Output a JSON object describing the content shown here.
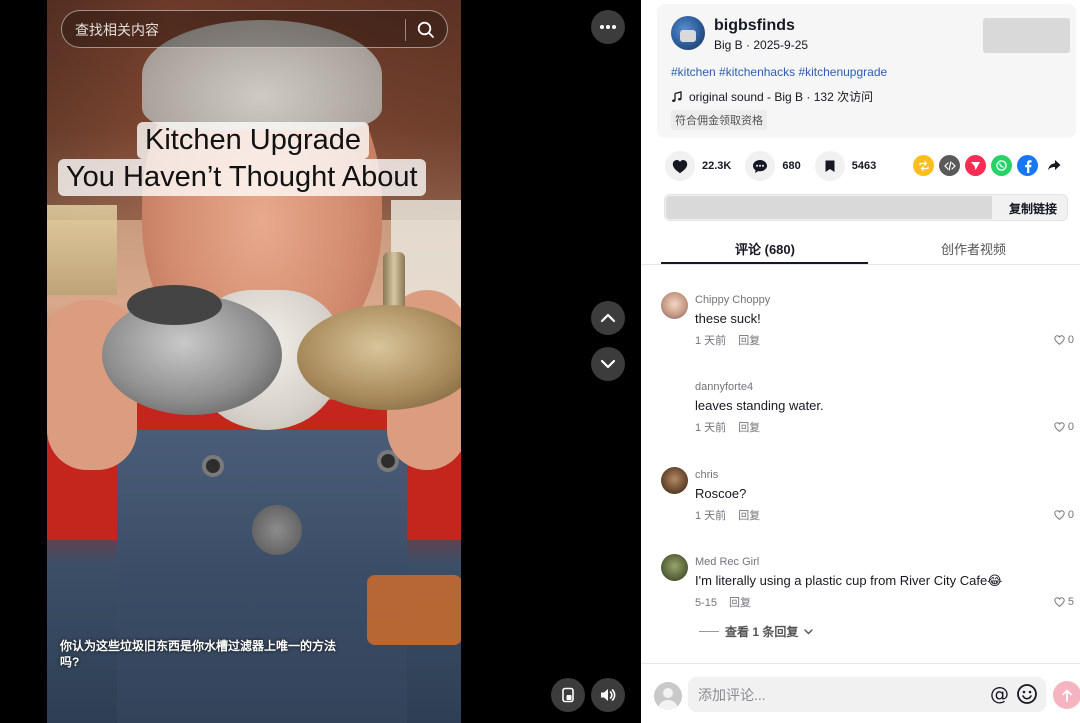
{
  "search": {
    "placeholder": "查找相关内容"
  },
  "video": {
    "title_line1": "Kitchen Upgrade",
    "title_line2": "You Haven’t Thought About",
    "caption": "你认为这些垃圾旧东西是你水槽过滤器上唯一的方法吗?"
  },
  "post": {
    "author": "bigbsfinds",
    "subline": "Big B · 2025-9-25",
    "hashtags": [
      "#kitchen",
      "#kitchenhacks",
      "#kitchenupgrade"
    ],
    "music": "original sound - Big B · 132 次访问",
    "badge": "符合佣金领取资格"
  },
  "actions": {
    "likes": "22.3K",
    "comments": "680",
    "saves": "5463",
    "copy_link": "复制链接"
  },
  "share_colors": {
    "repost": "#fcbd1f",
    "embed": "#5a5a5a",
    "send": "#fe2c55",
    "whatsapp": "#25d366",
    "facebook": "#1877f2",
    "more": "#161823"
  },
  "tabs": {
    "comments": "评论 (680)",
    "creator": "创作者视频"
  },
  "comments": [
    {
      "user": "Chippy Choppy",
      "text": "these suck!",
      "date": "1 天前",
      "reply": "回复",
      "likes": "0"
    },
    {
      "user": "dannyforte4",
      "text": "leaves standing water.",
      "date": "1 天前",
      "reply": "回复",
      "likes": "0"
    },
    {
      "user": "chris",
      "text": "Roscoe?",
      "date": "1 天前",
      "reply": "回复",
      "likes": "0"
    },
    {
      "user": "Med Rec Girl",
      "text": "I'm literally using a plastic cup from River City Cafe😂",
      "date": "5-15",
      "reply": "回复",
      "likes": "5"
    }
  ],
  "more_replies": "查看 1 条回复",
  "composer": {
    "placeholder": "添加评论...",
    "at": "@"
  }
}
